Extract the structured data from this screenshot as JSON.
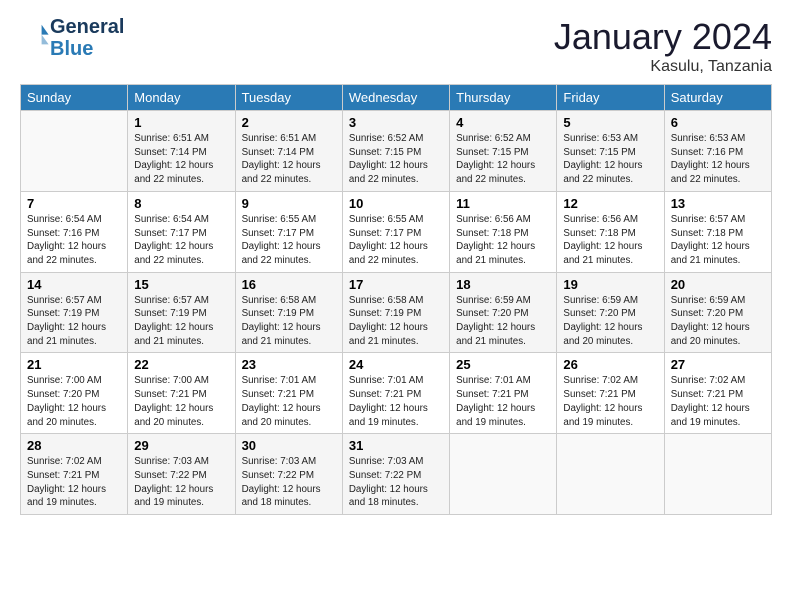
{
  "logo": {
    "line1": "General",
    "line2": "Blue"
  },
  "title": "January 2024",
  "location": "Kasulu, Tanzania",
  "weekdays": [
    "Sunday",
    "Monday",
    "Tuesday",
    "Wednesday",
    "Thursday",
    "Friday",
    "Saturday"
  ],
  "weeks": [
    [
      {
        "day": "",
        "info": ""
      },
      {
        "day": "1",
        "info": "Sunrise: 6:51 AM\nSunset: 7:14 PM\nDaylight: 12 hours\nand 22 minutes."
      },
      {
        "day": "2",
        "info": "Sunrise: 6:51 AM\nSunset: 7:14 PM\nDaylight: 12 hours\nand 22 minutes."
      },
      {
        "day": "3",
        "info": "Sunrise: 6:52 AM\nSunset: 7:15 PM\nDaylight: 12 hours\nand 22 minutes."
      },
      {
        "day": "4",
        "info": "Sunrise: 6:52 AM\nSunset: 7:15 PM\nDaylight: 12 hours\nand 22 minutes."
      },
      {
        "day": "5",
        "info": "Sunrise: 6:53 AM\nSunset: 7:15 PM\nDaylight: 12 hours\nand 22 minutes."
      },
      {
        "day": "6",
        "info": "Sunrise: 6:53 AM\nSunset: 7:16 PM\nDaylight: 12 hours\nand 22 minutes."
      }
    ],
    [
      {
        "day": "7",
        "info": "Sunrise: 6:54 AM\nSunset: 7:16 PM\nDaylight: 12 hours\nand 22 minutes."
      },
      {
        "day": "8",
        "info": "Sunrise: 6:54 AM\nSunset: 7:17 PM\nDaylight: 12 hours\nand 22 minutes."
      },
      {
        "day": "9",
        "info": "Sunrise: 6:55 AM\nSunset: 7:17 PM\nDaylight: 12 hours\nand 22 minutes."
      },
      {
        "day": "10",
        "info": "Sunrise: 6:55 AM\nSunset: 7:17 PM\nDaylight: 12 hours\nand 22 minutes."
      },
      {
        "day": "11",
        "info": "Sunrise: 6:56 AM\nSunset: 7:18 PM\nDaylight: 12 hours\nand 21 minutes."
      },
      {
        "day": "12",
        "info": "Sunrise: 6:56 AM\nSunset: 7:18 PM\nDaylight: 12 hours\nand 21 minutes."
      },
      {
        "day": "13",
        "info": "Sunrise: 6:57 AM\nSunset: 7:18 PM\nDaylight: 12 hours\nand 21 minutes."
      }
    ],
    [
      {
        "day": "14",
        "info": "Sunrise: 6:57 AM\nSunset: 7:19 PM\nDaylight: 12 hours\nand 21 minutes."
      },
      {
        "day": "15",
        "info": "Sunrise: 6:57 AM\nSunset: 7:19 PM\nDaylight: 12 hours\nand 21 minutes."
      },
      {
        "day": "16",
        "info": "Sunrise: 6:58 AM\nSunset: 7:19 PM\nDaylight: 12 hours\nand 21 minutes."
      },
      {
        "day": "17",
        "info": "Sunrise: 6:58 AM\nSunset: 7:19 PM\nDaylight: 12 hours\nand 21 minutes."
      },
      {
        "day": "18",
        "info": "Sunrise: 6:59 AM\nSunset: 7:20 PM\nDaylight: 12 hours\nand 21 minutes."
      },
      {
        "day": "19",
        "info": "Sunrise: 6:59 AM\nSunset: 7:20 PM\nDaylight: 12 hours\nand 20 minutes."
      },
      {
        "day": "20",
        "info": "Sunrise: 6:59 AM\nSunset: 7:20 PM\nDaylight: 12 hours\nand 20 minutes."
      }
    ],
    [
      {
        "day": "21",
        "info": "Sunrise: 7:00 AM\nSunset: 7:20 PM\nDaylight: 12 hours\nand 20 minutes."
      },
      {
        "day": "22",
        "info": "Sunrise: 7:00 AM\nSunset: 7:21 PM\nDaylight: 12 hours\nand 20 minutes."
      },
      {
        "day": "23",
        "info": "Sunrise: 7:01 AM\nSunset: 7:21 PM\nDaylight: 12 hours\nand 20 minutes."
      },
      {
        "day": "24",
        "info": "Sunrise: 7:01 AM\nSunset: 7:21 PM\nDaylight: 12 hours\nand 19 minutes."
      },
      {
        "day": "25",
        "info": "Sunrise: 7:01 AM\nSunset: 7:21 PM\nDaylight: 12 hours\nand 19 minutes."
      },
      {
        "day": "26",
        "info": "Sunrise: 7:02 AM\nSunset: 7:21 PM\nDaylight: 12 hours\nand 19 minutes."
      },
      {
        "day": "27",
        "info": "Sunrise: 7:02 AM\nSunset: 7:21 PM\nDaylight: 12 hours\nand 19 minutes."
      }
    ],
    [
      {
        "day": "28",
        "info": "Sunrise: 7:02 AM\nSunset: 7:21 PM\nDaylight: 12 hours\nand 19 minutes."
      },
      {
        "day": "29",
        "info": "Sunrise: 7:03 AM\nSunset: 7:22 PM\nDaylight: 12 hours\nand 19 minutes."
      },
      {
        "day": "30",
        "info": "Sunrise: 7:03 AM\nSunset: 7:22 PM\nDaylight: 12 hours\nand 18 minutes."
      },
      {
        "day": "31",
        "info": "Sunrise: 7:03 AM\nSunset: 7:22 PM\nDaylight: 12 hours\nand 18 minutes."
      },
      {
        "day": "",
        "info": ""
      },
      {
        "day": "",
        "info": ""
      },
      {
        "day": "",
        "info": ""
      }
    ]
  ]
}
